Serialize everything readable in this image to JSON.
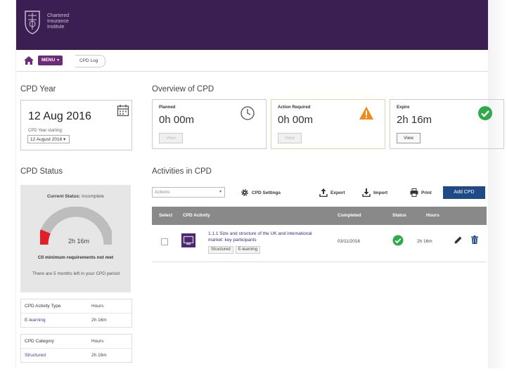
{
  "header": {
    "logo_text": [
      "Chartered",
      "Insurance",
      "Institute"
    ]
  },
  "breadcrumb": {
    "menu_label": "MENU",
    "current": "CPD Log"
  },
  "cpd_year": {
    "title": "CPD Year",
    "date": "12 Aug 2016",
    "starting_label": "CPD Year starting:",
    "selected": "12 August 2016 ▾"
  },
  "overview": {
    "title": "Overview of CPD",
    "cards": [
      {
        "label": "Planned",
        "hours": "0h 00m",
        "button": "View",
        "icon": "clock-icon"
      },
      {
        "label": "Action Required",
        "hours": "0h 00m",
        "button": "View",
        "icon": "warning-icon"
      },
      {
        "label": "Expire",
        "hours": "2h 16m",
        "button": "View",
        "icon": "check-circle-icon"
      }
    ]
  },
  "cpd_status": {
    "title": "CPD Status",
    "current_label": "Current Status:",
    "current_value": "Incomplete",
    "gauge_value": "2h 16m",
    "gauge_fraction": 0.13,
    "minimum_text": "CII minimum requirements not met",
    "note": "There are 5 months left in your CPD period"
  },
  "activity_type_table": {
    "headers": [
      "CPD Activity Type",
      "Hours"
    ],
    "rows": [
      [
        "E-learning",
        "2h 16m"
      ]
    ]
  },
  "category_table": {
    "headers": [
      "CPD Category",
      "Hours"
    ],
    "rows": [
      [
        "Structured",
        "2h 16m"
      ]
    ]
  },
  "activities": {
    "title": "Activities in CPD",
    "actions_placeholder": "Actions",
    "toolbar": {
      "settings": "CPD Settings",
      "export": "Export",
      "import": "Import",
      "print": "Print",
      "add": "Add CPD"
    },
    "columns": [
      "Select",
      "CPD Activity",
      "Completed",
      "Status",
      "Hours"
    ],
    "rows": [
      {
        "name": "1.1.1 Size and structure of the UK and international market: key participants",
        "tags": [
          "Structured",
          "E-learning"
        ],
        "completed": "03/11/2016",
        "status": "check-circle-icon",
        "hours": "2h 16m"
      }
    ]
  },
  "colors": {
    "header_bg": "#3b1f52",
    "menu_pill": "#6b2b79",
    "add_button": "#1e4a86",
    "success": "#2eaa4a",
    "warning": "#ef8a1e",
    "gauge_fill": "#e01f26"
  }
}
